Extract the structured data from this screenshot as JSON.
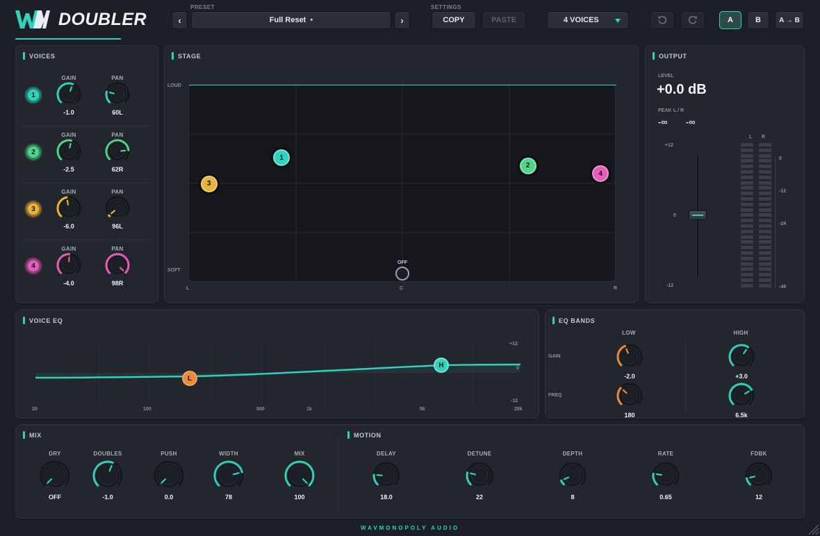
{
  "header": {
    "app_title": "DOUBLER",
    "preset_label": "PRESET",
    "preset_name": "Full Reset",
    "preset_dot": "•",
    "prev_glyph": "‹",
    "next_glyph": "›",
    "settings_label": "SETTINGS",
    "copy_label": "COPY",
    "paste_label": "PASTE",
    "voices_select": "4 VOICES",
    "undo_icon": "undo-icon",
    "redo_icon": "redo-icon",
    "ab": {
      "a": "A",
      "b": "B",
      "a_to_b": "A → B"
    }
  },
  "colors": {
    "accent": "#2fd3bd",
    "voice1": "#2fd3bd",
    "voice2": "#4dd68a",
    "voice3": "#e8b33c",
    "voice4": "#e45db8",
    "eq_low": "#ec8a3c"
  },
  "voices": {
    "title": "VOICES",
    "gain_label": "GAIN",
    "pan_label": "PAN",
    "items": [
      {
        "num": "1",
        "gain": "-1.0",
        "pan": "60L",
        "gain_pos": 0.58,
        "pan_pos": 0.22
      },
      {
        "num": "2",
        "gain": "-2.5",
        "pan": "62R",
        "gain_pos": 0.55,
        "pan_pos": 0.81
      },
      {
        "num": "3",
        "gain": "-6.0",
        "pan": "96L",
        "gain_pos": 0.46,
        "pan_pos": 0.02
      },
      {
        "num": "4",
        "gain": "-4.0",
        "pan": "98R",
        "gain_pos": 0.51,
        "pan_pos": 0.99
      }
    ]
  },
  "stage": {
    "title": "STAGE",
    "y_top": "LOUD",
    "y_bottom": "SOFT",
    "x_left": "L",
    "x_center": "C",
    "x_right": "R",
    "off_label": "OFF",
    "points": [
      {
        "num": "1",
        "pan": -0.6,
        "level": 0.63
      },
      {
        "num": "2",
        "pan": 0.62,
        "level": 0.59
      },
      {
        "num": "3",
        "pan": -0.96,
        "level": 0.5
      },
      {
        "num": "4",
        "pan": 0.98,
        "level": 0.55
      }
    ]
  },
  "output": {
    "title": "OUTPUT",
    "level_label": "LEVEL",
    "level_value": "+0.0 dB",
    "peak_label": "PEAK",
    "peak_lr": "L / R",
    "peak_l": "-∞",
    "peak_r": "-∞",
    "fader_top": "+12",
    "fader_mid": "0",
    "fader_bottom": "-12",
    "meter_l": "L",
    "meter_r": "R",
    "meter_scale": [
      "0",
      "-12",
      "-24",
      "-48"
    ],
    "fader_db": 0
  },
  "voice_eq": {
    "title": "VOICE EQ",
    "x_ticks": [
      "20",
      "100",
      "500",
      "1k",
      "5k",
      "20k"
    ],
    "y_top": "+12",
    "y_mid": "0",
    "y_bottom": "-12",
    "low_node": "L",
    "high_node": "H"
  },
  "eq_bands": {
    "title": "EQ BANDS",
    "low_label": "LOW",
    "high_label": "HIGH",
    "gain_label": "GAIN",
    "freq_label": "FREQ",
    "low_gain": "-2.0",
    "high_gain": "+3.0",
    "low_freq": "180",
    "high_freq": "6.5k"
  },
  "mix": {
    "title": "MIX",
    "knobs": [
      {
        "label": "DRY",
        "value": "OFF",
        "pos": 0.0
      },
      {
        "label": "DOUBLES",
        "value": "-1.0",
        "pos": 0.58
      },
      {
        "label": "PUSH",
        "value": "0.0",
        "pos": 0.0
      },
      {
        "label": "WIDTH",
        "value": "78",
        "pos": 0.78
      },
      {
        "label": "MIX",
        "value": "100",
        "pos": 1.0
      }
    ]
  },
  "motion": {
    "title": "MOTION",
    "knobs": [
      {
        "label": "DELAY",
        "value": "18.0",
        "pos": 0.18
      },
      {
        "label": "DETUNE",
        "value": "22",
        "pos": 0.22
      },
      {
        "label": "DEPTH",
        "value": "8",
        "pos": 0.08
      },
      {
        "label": "RATE",
        "value": "0.65",
        "pos": 0.2
      },
      {
        "label": "FDBK",
        "value": "12",
        "pos": 0.12
      }
    ]
  },
  "footer": {
    "brand": "WAVMONOPOLY AUDIO"
  }
}
